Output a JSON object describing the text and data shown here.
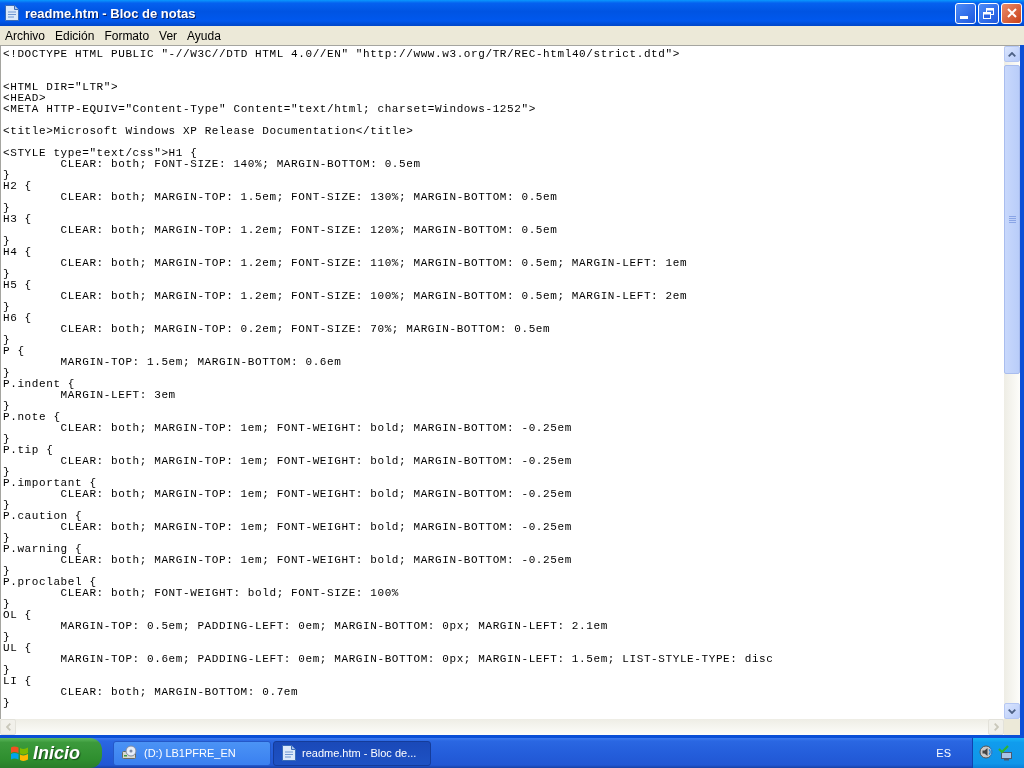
{
  "window": {
    "title": "readme.htm - Bloc de notas"
  },
  "menu": [
    "Archivo",
    "Edición",
    "Formato",
    "Ver",
    "Ayuda"
  ],
  "document": {
    "lines": [
      {
        "kind": "code",
        "text": "<!DOCTYPE HTML PUBLIC \"-//W3C//DTD HTML 4.0//EN\" \"http://www.w3.org/TR/REC-html40/strict.dtd\">"
      },
      {
        "kind": "blank"
      },
      {
        "kind": "blank"
      },
      {
        "kind": "code",
        "text": "<HTML DIR=\"LTR\">"
      },
      {
        "kind": "code",
        "text": "<HEAD>"
      },
      {
        "kind": "code",
        "text": "<META HTTP-EQUIV=\"Content-Type\" Content=\"text/html; charset=Windows-1252\">"
      },
      {
        "kind": "blank"
      },
      {
        "kind": "code",
        "text": "<title>Microsoft Windows XP Release Documentation</title>"
      },
      {
        "kind": "blank"
      },
      {
        "kind": "code",
        "text": "<STYLE type=\"text/css\">H1 {",
        "children": [
          {
            "kind": "code",
            "text": "CLEAR: both; FONT-SIZE: 140%; MARGIN-BOTTOM: 0.5em"
          }
        ]
      },
      {
        "kind": "code",
        "text": "}"
      },
      {
        "kind": "code",
        "text": "H2 {",
        "children": [
          {
            "kind": "code",
            "text": "CLEAR: both; MARGIN-TOP: 1.5em; FONT-SIZE: 130%; MARGIN-BOTTOM: 0.5em"
          }
        ]
      },
      {
        "kind": "code",
        "text": "}"
      },
      {
        "kind": "code",
        "text": "H3 {",
        "children": [
          {
            "kind": "code",
            "text": "CLEAR: both; MARGIN-TOP: 1.2em; FONT-SIZE: 120%; MARGIN-BOTTOM: 0.5em"
          }
        ]
      },
      {
        "kind": "code",
        "text": "}"
      },
      {
        "kind": "code",
        "text": "H4 {",
        "children": [
          {
            "kind": "code",
            "text": "CLEAR: both; MARGIN-TOP: 1.2em; FONT-SIZE: 110%; MARGIN-BOTTOM: 0.5em; MARGIN-LEFT: 1em"
          }
        ]
      },
      {
        "kind": "code",
        "text": "}"
      },
      {
        "kind": "code",
        "text": "H5 {",
        "children": [
          {
            "kind": "code",
            "text": "CLEAR: both; MARGIN-TOP: 1.2em; FONT-SIZE: 100%; MARGIN-BOTTOM: 0.5em; MARGIN-LEFT: 2em"
          }
        ]
      },
      {
        "kind": "code",
        "text": "}"
      },
      {
        "kind": "code",
        "text": "H6 {",
        "children": [
          {
            "kind": "code",
            "text": "CLEAR: both; MARGIN-TOP: 0.2em; FONT-SIZE: 70%; MARGIN-BOTTOM: 0.5em"
          }
        ]
      },
      {
        "kind": "code",
        "text": "}"
      },
      {
        "kind": "code",
        "text": "P {",
        "children": [
          {
            "kind": "code",
            "text": "MARGIN-TOP: 1.5em; MARGIN-BOTTOM: 0.6em"
          }
        ]
      },
      {
        "kind": "code",
        "text": "}"
      },
      {
        "kind": "code",
        "text": "P.indent {",
        "children": [
          {
            "kind": "code",
            "text": "MARGIN-LEFT: 3em"
          }
        ]
      },
      {
        "kind": "code",
        "text": "}"
      },
      {
        "kind": "code",
        "text": "P.note {",
        "children": [
          {
            "kind": "code",
            "text": "CLEAR: both; MARGIN-TOP: 1em; FONT-WEIGHT: bold; MARGIN-BOTTOM: -0.25em"
          }
        ]
      },
      {
        "kind": "code",
        "text": "}"
      },
      {
        "kind": "code",
        "text": "P.tip {",
        "children": [
          {
            "kind": "code",
            "text": "CLEAR: both; MARGIN-TOP: 1em; FONT-WEIGHT: bold; MARGIN-BOTTOM: -0.25em"
          }
        ]
      },
      {
        "kind": "code",
        "text": "}"
      },
      {
        "kind": "code",
        "text": "P.important {",
        "children": [
          {
            "kind": "code",
            "text": "CLEAR: both; MARGIN-TOP: 1em; FONT-WEIGHT: bold; MARGIN-BOTTOM: -0.25em"
          }
        ]
      },
      {
        "kind": "code",
        "text": "}"
      },
      {
        "kind": "code",
        "text": "P.caution {",
        "children": [
          {
            "kind": "code",
            "text": "CLEAR: both; MARGIN-TOP: 1em; FONT-WEIGHT: bold; MARGIN-BOTTOM: -0.25em"
          }
        ]
      },
      {
        "kind": "code",
        "text": "}"
      },
      {
        "kind": "code",
        "text": "P.warning {",
        "children": [
          {
            "kind": "code",
            "text": "CLEAR: both; MARGIN-TOP: 1em; FONT-WEIGHT: bold; MARGIN-BOTTOM: -0.25em"
          }
        ]
      },
      {
        "kind": "code",
        "text": "}"
      },
      {
        "kind": "code",
        "text": "P.proclabel {",
        "children": [
          {
            "kind": "code",
            "text": "CLEAR: both; FONT-WEIGHT: bold; FONT-SIZE: 100%"
          }
        ]
      },
      {
        "kind": "code",
        "text": "}"
      },
      {
        "kind": "code",
        "text": "OL {",
        "children": [
          {
            "kind": "code",
            "text": "MARGIN-TOP: 0.5em; PADDING-LEFT: 0em; MARGIN-BOTTOM: 0px; MARGIN-LEFT: 2.1em"
          }
        ]
      },
      {
        "kind": "code",
        "text": "}"
      },
      {
        "kind": "code",
        "text": "UL {",
        "children": [
          {
            "kind": "code",
            "text": "MARGIN-TOP: 0.6em; PADDING-LEFT: 0em; MARGIN-BOTTOM: 0px; MARGIN-LEFT: 1.5em; LIST-STYLE-TYPE: disc"
          }
        ]
      },
      {
        "kind": "code",
        "text": "}"
      },
      {
        "kind": "code",
        "text": "LI {",
        "children": [
          {
            "kind": "code",
            "text": "CLEAR: both; MARGIN-BOTTOM: 0.7em"
          }
        ]
      },
      {
        "kind": "code",
        "text": "}"
      }
    ],
    "horizontal_scrollbar": {
      "disabled": true
    }
  },
  "taskbar": {
    "start": "Inicio",
    "tasks": [
      {
        "kind": "drive",
        "label": "(D:) LB1PFRE_EN",
        "selected": false
      },
      {
        "kind": "notepad",
        "label": "readme.htm - Bloc de...",
        "selected": true
      }
    ],
    "language": "ES"
  }
}
